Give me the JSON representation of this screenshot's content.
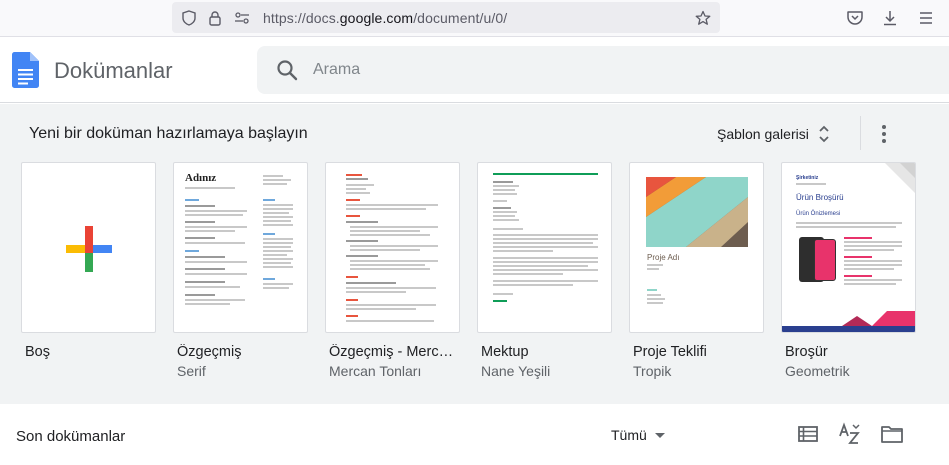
{
  "browser": {
    "url_prefix": "https://docs.",
    "url_domain": "google.com",
    "url_path": "/document/u/0/",
    "icons": [
      "shield-icon",
      "lock-icon",
      "permissions-icon",
      "bookmark-star-icon",
      "pocket-icon",
      "download-icon",
      "menu-icon"
    ]
  },
  "header": {
    "app_title": "Dokümanlar",
    "search_placeholder": "Arama"
  },
  "templates_section": {
    "title": "Yeni bir doküman hazırlamaya başlayın",
    "gallery_label": "Şablon galerisi",
    "items": [
      {
        "name": "Boş",
        "subtitle": ""
      },
      {
        "name": "Özgeçmiş",
        "subtitle": "Serif"
      },
      {
        "name": "Özgeçmiş - Mercan Tonları",
        "subtitle": "Mercan Tonları"
      },
      {
        "name": "Mektup",
        "subtitle": "Nane Yeşili"
      },
      {
        "name": "Proje Teklifi",
        "subtitle": "Tropik"
      },
      {
        "name": "Broşür",
        "subtitle": "Geometrik"
      }
    ],
    "thumb_text": {
      "resume_name": "Adınız",
      "proposal_title": "Proje Adı",
      "brochure_company": "Şirketiniz",
      "brochure_title": "Ürün Broşürü",
      "brochure_heading": "Ürün Önizlemesi"
    }
  },
  "recent": {
    "title": "Son dokümanlar",
    "owner_filter": "Tümü"
  },
  "colors": {
    "docs_blue": "#4285f4",
    "plus_red": "#ea4335",
    "plus_yellow": "#fbbc04",
    "plus_green": "#34a853",
    "section_bg": "#f1f3f4",
    "coral": "#e8553e",
    "mint": "#0f9d58",
    "tropic_teal": "#8fd5c9",
    "brochure_pink": "#e8336b",
    "brochure_navy": "#2a3f8f"
  }
}
